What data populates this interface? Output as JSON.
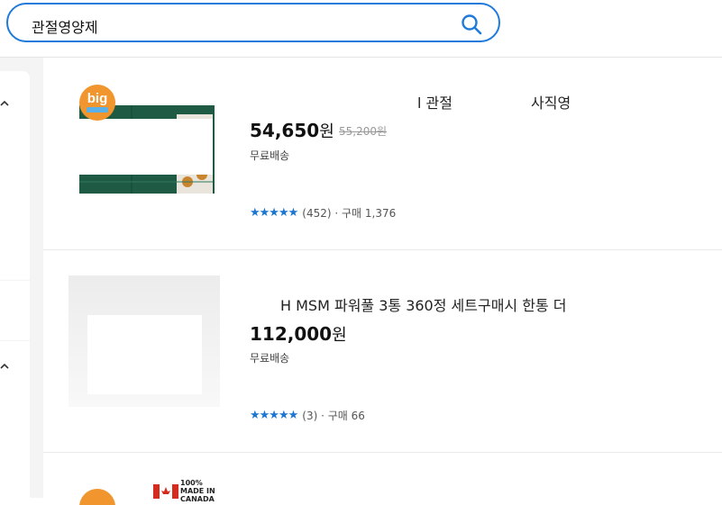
{
  "search": {
    "query": "관절영양제"
  },
  "products": [
    {
      "title_a": "l 관절",
      "title_b": "사직영",
      "price": "54,650",
      "won": "원",
      "old_price": "55,200원",
      "shipping": "무료배송",
      "stars": "★★★★★",
      "rating_text": "(452) · 구매 1,376",
      "badge": "big"
    },
    {
      "title": "H MSM 파워풀 3통 360정 세트구매시 한통 더",
      "price": "112,000",
      "won": "원",
      "shipping": "무료배송",
      "stars": "★★★★★",
      "rating_text": "(3) · 구매 66"
    },
    {
      "badge": "big",
      "origin_label": "100% MADE IN CANADA"
    }
  ],
  "colors": {
    "accent": "#1f7ad9",
    "star": "#1b76d2"
  }
}
